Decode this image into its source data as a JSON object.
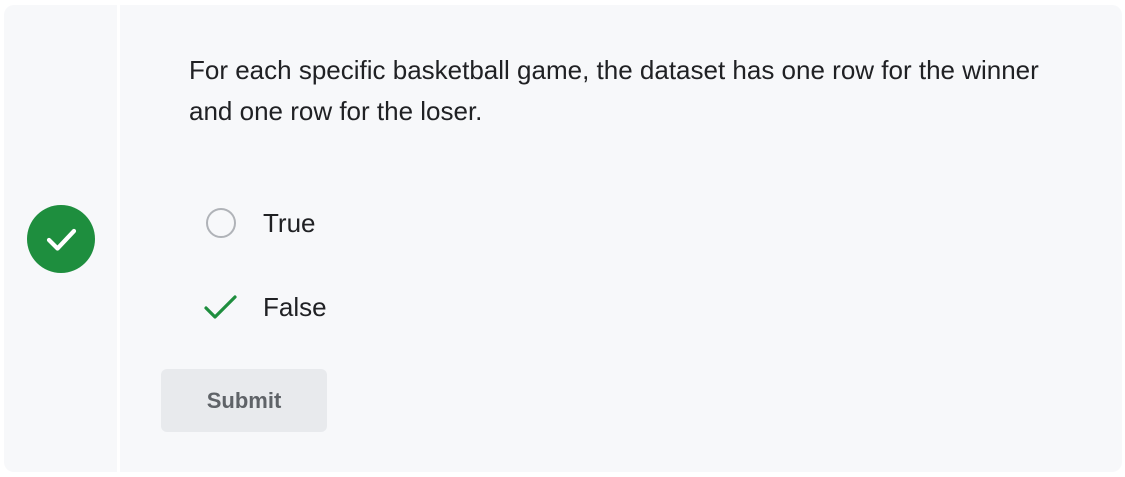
{
  "quiz": {
    "status": "correct",
    "status_icon": "checkmark-icon",
    "status_color": "#1e8e3e",
    "question": "For each specific basketball game, the dataset has one row for the winner and one row for the loser.",
    "options": [
      {
        "label": "True",
        "selected": false,
        "icon": "radio-unselected-icon"
      },
      {
        "label": "False",
        "selected": true,
        "icon": "correct-check-icon"
      }
    ],
    "submit_label": "Submit"
  }
}
